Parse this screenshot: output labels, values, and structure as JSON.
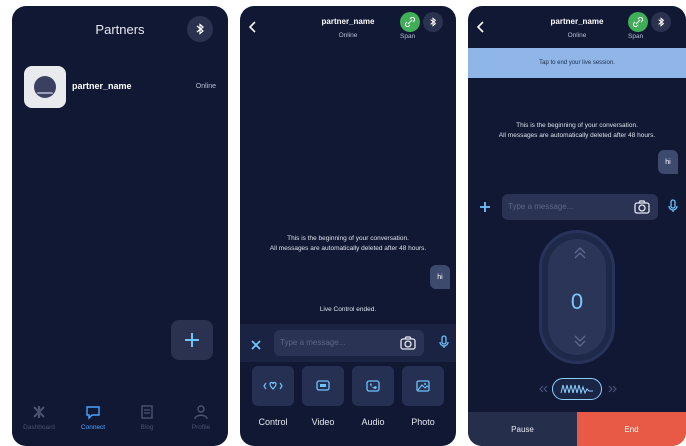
{
  "colors": {
    "background": "#101834",
    "accent": "#4aa3ff",
    "link_green": "#3fae57",
    "end_red": "#e85a45",
    "banner_blue": "#8fb6e6"
  },
  "partners_screen": {
    "title": "Partners",
    "partner": {
      "name": "partner_name",
      "status": "Online"
    },
    "nav": [
      {
        "label": "Dashboard",
        "icon": "dashboard-icon"
      },
      {
        "label": "Connect",
        "icon": "chat-icon"
      },
      {
        "label": "Blog",
        "icon": "blog-icon"
      },
      {
        "label": "Profile",
        "icon": "profile-icon"
      }
    ]
  },
  "chat_screen": {
    "header": {
      "name": "partner_name",
      "status": "Online",
      "link_label": "Span"
    },
    "system_message_line1": "This is the beginning of your conversation.",
    "system_message_line2": "All messages are automatically deleted after 48 hours.",
    "message": "hi",
    "status_message": "Live Control ended.",
    "input_placeholder": "Type a message...",
    "actions": [
      {
        "label": "Control",
        "icon": "control-icon"
      },
      {
        "label": "Video",
        "icon": "video-icon"
      },
      {
        "label": "Audio",
        "icon": "phone-icon"
      },
      {
        "label": "Photo",
        "icon": "photo-icon"
      }
    ]
  },
  "control_screen": {
    "header": {
      "name": "partner_name",
      "status": "Online",
      "link_label": "Span"
    },
    "banner": "Tap to end your live session.",
    "system_message_line1": "This is the beginning of your conversation.",
    "system_message_line2": "All messages are automatically deleted after 48 hours.",
    "message": "hi",
    "input_placeholder": "Type a message...",
    "intensity": "0",
    "pause_label": "Pause",
    "end_label": "End"
  }
}
